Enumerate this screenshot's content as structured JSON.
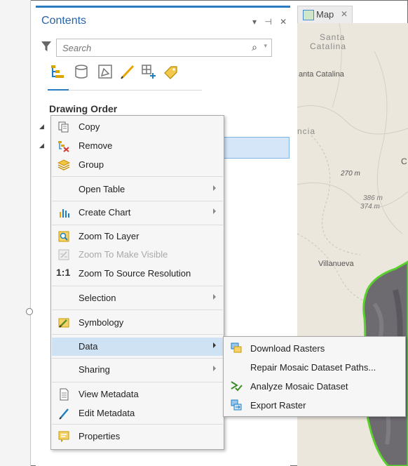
{
  "contents_pane": {
    "title": "Contents",
    "controls": "▾ ⊣ ✕",
    "search_placeholder": "Search",
    "section_heading": "Drawing Order"
  },
  "map_tab": {
    "label": "Map",
    "close": "✕"
  },
  "map_labels": {
    "santa_catalina_top_1": "Santa",
    "santa_catalina_top_2": "Catalina",
    "santa_catalina": "anta Catalina",
    "ncia": "ncia",
    "c_letter": "C",
    "elev_270": "270 m",
    "elev_386": "386 m",
    "elev_374": "374 m",
    "villanueva": "Villanueva"
  },
  "context_menu": {
    "items": [
      {
        "label": "Copy",
        "icon": "copy-icon"
      },
      {
        "label": "Remove",
        "icon": "remove-icon"
      },
      {
        "label": "Group",
        "icon": "group-icon"
      },
      {
        "label": "Open Table",
        "icon": ""
      },
      {
        "label": "Create Chart",
        "icon": "chart-icon"
      },
      {
        "label": "Zoom To Layer",
        "icon": "zoom-to-layer-icon"
      },
      {
        "label": "Zoom To Make Visible",
        "icon": "zoom-to-make-visible-icon"
      },
      {
        "label": "Zoom To Source Resolution",
        "icon": "one-to-one-icon",
        "icon_text": "1:1"
      },
      {
        "label": "Selection",
        "icon": ""
      },
      {
        "label": "Symbology",
        "icon": "symbology-icon"
      },
      {
        "label": "Data",
        "icon": ""
      },
      {
        "label": "Sharing",
        "icon": ""
      },
      {
        "label": "View Metadata",
        "icon": "view-metadata-icon"
      },
      {
        "label": "Edit Metadata",
        "icon": "edit-metadata-icon"
      },
      {
        "label": "Properties",
        "icon": "properties-icon"
      }
    ]
  },
  "data_submenu": {
    "items": [
      {
        "label": "Download Rasters",
        "icon": "download-rasters-icon"
      },
      {
        "label": "Repair Mosaic Dataset Paths...",
        "icon": ""
      },
      {
        "label": "Analyze Mosaic Dataset",
        "icon": "analyze-icon"
      },
      {
        "label": "Export Raster",
        "icon": "export-raster-icon"
      }
    ]
  },
  "colors": {
    "accent": "#2a7bbf",
    "highlight": "#cfe2f3",
    "raster_outline": "#5ad12e"
  }
}
